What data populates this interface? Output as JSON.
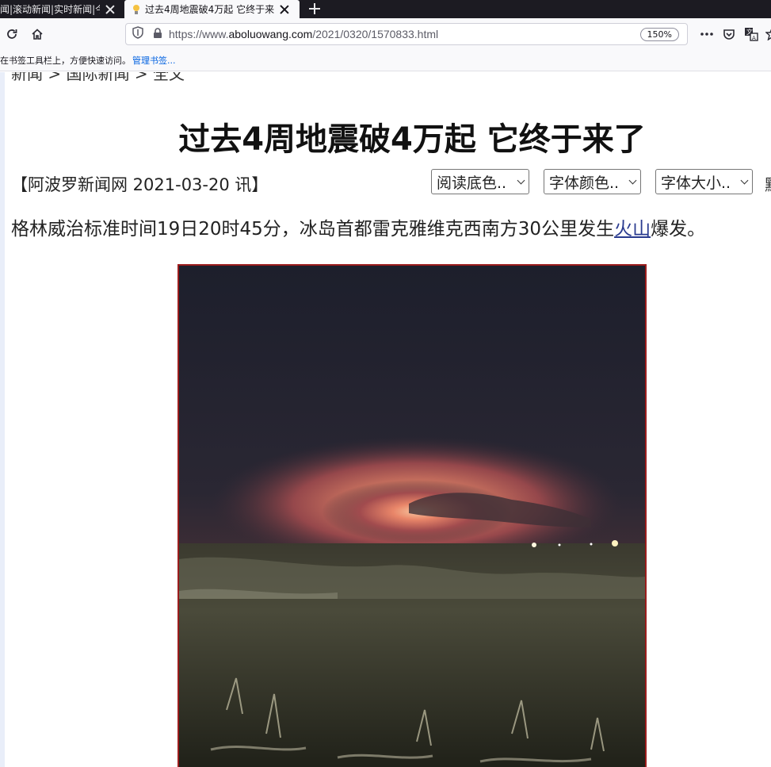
{
  "browser": {
    "tabs": [
      {
        "title": "闻|滚动新闻|实时新闻|今",
        "active": false
      },
      {
        "title": "过去4周地震破4万起 它终于来",
        "active": true
      }
    ],
    "url_prefix": "https://www.",
    "url_domain": "aboluowang.com",
    "url_path": "/2021/0320/1570833.html",
    "zoom": "150%",
    "bookmarks_hint": "在书签工具栏上，方便快速访问。",
    "bookmarks_manage": "管理书签..."
  },
  "article": {
    "breadcrumb": "新闻 > 国际新闻 > 全文",
    "headline": "过去4周地震破4万起 它终于来了",
    "source": "【阿波罗新闻网 2021-03-20 讯】",
    "controls": {
      "bg_color": "阅读底色..",
      "font_color": "字体颜色..",
      "font_size": "字体大小..",
      "trailing": "默"
    },
    "lede_before": "格林威治标准时间19日20时45分，冰岛首都雷克雅维克西南方30公里发生",
    "lede_link": "火山",
    "lede_after": "爆发。"
  },
  "colors": {
    "tabstrip": "#1c1b22",
    "link": "#2a3b8f",
    "photo_border": "#9b1c1c"
  },
  "icons": [
    "close-icon",
    "plus-icon",
    "reload-icon",
    "home-icon",
    "shield-icon",
    "lock-icon",
    "more-icon",
    "pocket-icon",
    "translate-icon",
    "bookmark-star-icon"
  ]
}
